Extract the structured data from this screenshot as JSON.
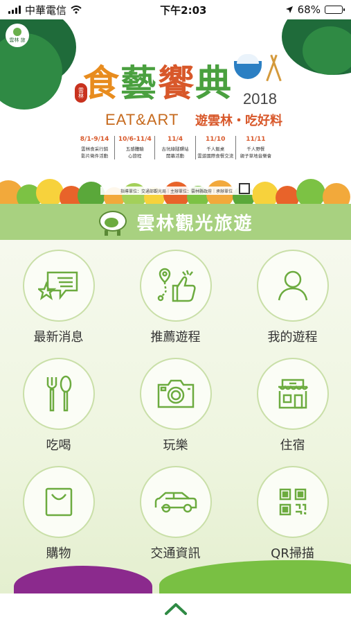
{
  "status_bar": {
    "carrier": "中華電信",
    "time": "下午2:03",
    "battery": "68%",
    "battery_level": 0.68
  },
  "banner": {
    "logo_text": "雲林 旅",
    "seal": "雲林",
    "title_chars": [
      "食",
      "藝",
      "饗",
      "典"
    ],
    "subtitle": "EAT&ART",
    "year": "2018",
    "tagline": "遊雲林・吃好料",
    "schedule": [
      {
        "date": "8/1-9/14",
        "line1": "雲林食采行銷",
        "line2": "影片徵件活動"
      },
      {
        "date": "10/6-11/4",
        "line1": "五感體驗",
        "line2": "心旅程"
      },
      {
        "date": "11/4",
        "line1": "古坑綠隧驛站",
        "line2": "開幕活動"
      },
      {
        "date": "11/10",
        "line1": "千人飯桌",
        "line2": "雲遊國際食餐交流"
      },
      {
        "date": "11/11",
        "line1": "千人野餐",
        "line2": "親子草地音樂會"
      }
    ],
    "sponsor_text": "指導單位：交通部觀光局｜主辦單位：雲林縣政府｜承辦單位"
  },
  "section": {
    "title": "雲林觀光旅遊"
  },
  "menu": [
    {
      "label": "最新消息",
      "icon": "news-star-icon"
    },
    {
      "label": "推薦遊程",
      "icon": "thumbs-up-route-icon"
    },
    {
      "label": "我的遊程",
      "icon": "person-icon"
    },
    {
      "label": "吃喝",
      "icon": "fork-spoon-icon"
    },
    {
      "label": "玩樂",
      "icon": "camera-icon"
    },
    {
      "label": "住宿",
      "icon": "building-icon"
    },
    {
      "label": "購物",
      "icon": "shopping-bag-icon"
    },
    {
      "label": "交通資訊",
      "icon": "car-icon"
    },
    {
      "label": "QR掃描",
      "icon": "qr-code-icon"
    }
  ],
  "colors": {
    "accent_green": "#6cab3f",
    "header_green": "#a8d180",
    "icon_stroke": "#6cab3f"
  }
}
